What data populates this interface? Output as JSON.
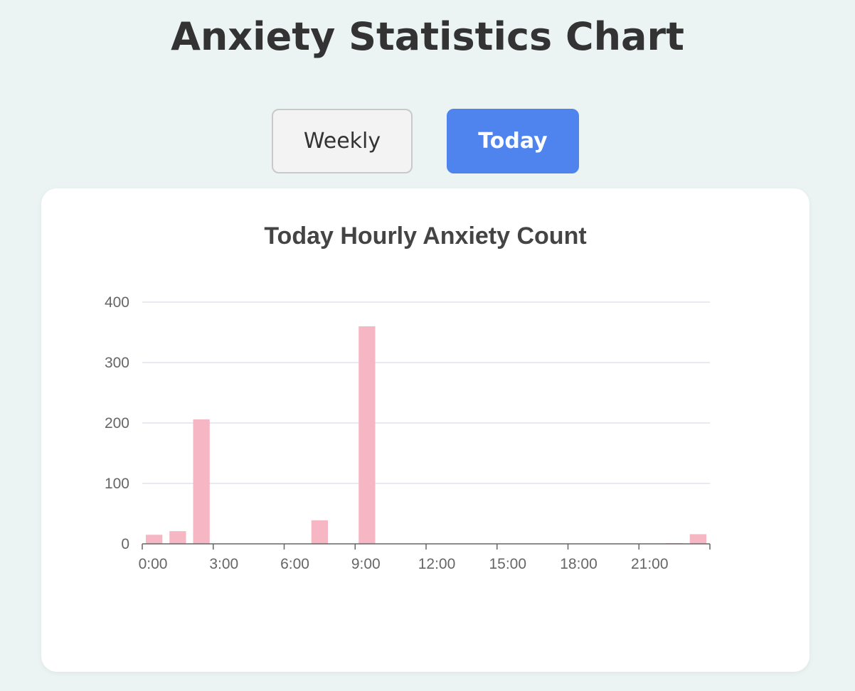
{
  "page": {
    "title": "Anxiety Statistics Chart"
  },
  "toggle": {
    "weekly_label": "Weekly",
    "today_label": "Today",
    "active": "Today",
    "active_color": "#4f84ee"
  },
  "chart_data": {
    "type": "bar",
    "title": "Today Hourly Anxiety Count",
    "xlabel": "",
    "ylabel": "",
    "categories": [
      "0:00",
      "1:00",
      "2:00",
      "3:00",
      "4:00",
      "5:00",
      "6:00",
      "7:00",
      "8:00",
      "9:00",
      "10:00",
      "11:00",
      "12:00",
      "13:00",
      "14:00",
      "15:00",
      "16:00",
      "17:00",
      "18:00",
      "19:00",
      "20:00",
      "21:00",
      "22:00",
      "23:00"
    ],
    "values": [
      15,
      21,
      206,
      0,
      0,
      0,
      0,
      39,
      0,
      360,
      0,
      0,
      0,
      0,
      0,
      0,
      0,
      0,
      0,
      0,
      0,
      0,
      1,
      16
    ],
    "x_tick_labels": [
      "0:00",
      "3:00",
      "6:00",
      "9:00",
      "12:00",
      "15:00",
      "18:00",
      "21:00"
    ],
    "y_ticks": [
      0,
      100,
      200,
      300,
      400
    ],
    "ylim": [
      0,
      400
    ],
    "grid": true,
    "bar_color": "#f6b6c3",
    "legend": false
  }
}
